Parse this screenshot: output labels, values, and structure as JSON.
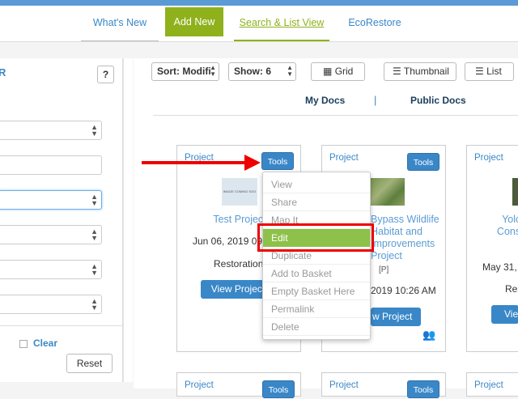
{
  "nav": {
    "tabs": [
      {
        "label": "What's New"
      },
      {
        "label": "Add New"
      },
      {
        "label": "Search & List View"
      },
      {
        "label": "EcoRestore"
      }
    ]
  },
  "sidebar": {
    "title_fragment": "R",
    "help_label": "?",
    "clear_label": "Clear",
    "reset_label": "Reset"
  },
  "toolbar": {
    "sort_label": "Sort: Modifi",
    "show_label": "Show: 6",
    "grid_label": "Grid",
    "thumbnail_label": "Thumbnail",
    "list_label": "List"
  },
  "docs_toggle": {
    "my_docs": "My Docs",
    "separator": "|",
    "public_docs": "Public Docs"
  },
  "cards": [
    {
      "type": "Project",
      "tools": "Tools",
      "thumb_text": "IMAGE COMING SOO",
      "title": "Test Project",
      "date": "Jun 06, 2019 09:0",
      "category": "Restoration",
      "view": "View Project"
    },
    {
      "type": "Project",
      "tools": "Tools",
      "title_lines": [
        "Bypass Wildlife",
        "Habitat and",
        "Improvements",
        "Project"
      ],
      "tag": "[P]",
      "date": "2019 10:26 AM",
      "view": "w Project"
    },
    {
      "type": "Project",
      "title_lines": [
        "Yolo",
        "Conse"
      ],
      "date": "May 31, 2",
      "category": "Res",
      "view": "Vie"
    }
  ],
  "bottom_cards": [
    {
      "type": "Project",
      "tools": "Tools"
    },
    {
      "type": "Project",
      "tools": "Tools"
    },
    {
      "type": "Project"
    }
  ],
  "tools_menu": {
    "items": [
      "View",
      "Share",
      "Map It",
      "Edit",
      "Duplicate",
      "Add to Basket",
      "Empty Basket Here",
      "Permalink",
      "Delete"
    ],
    "active_index": 3
  },
  "colors": {
    "accent": "#3a87c8",
    "add_new_green": "#8fb11c",
    "menu_active_green": "#8dc14a",
    "annotation_red": "#e00000"
  }
}
